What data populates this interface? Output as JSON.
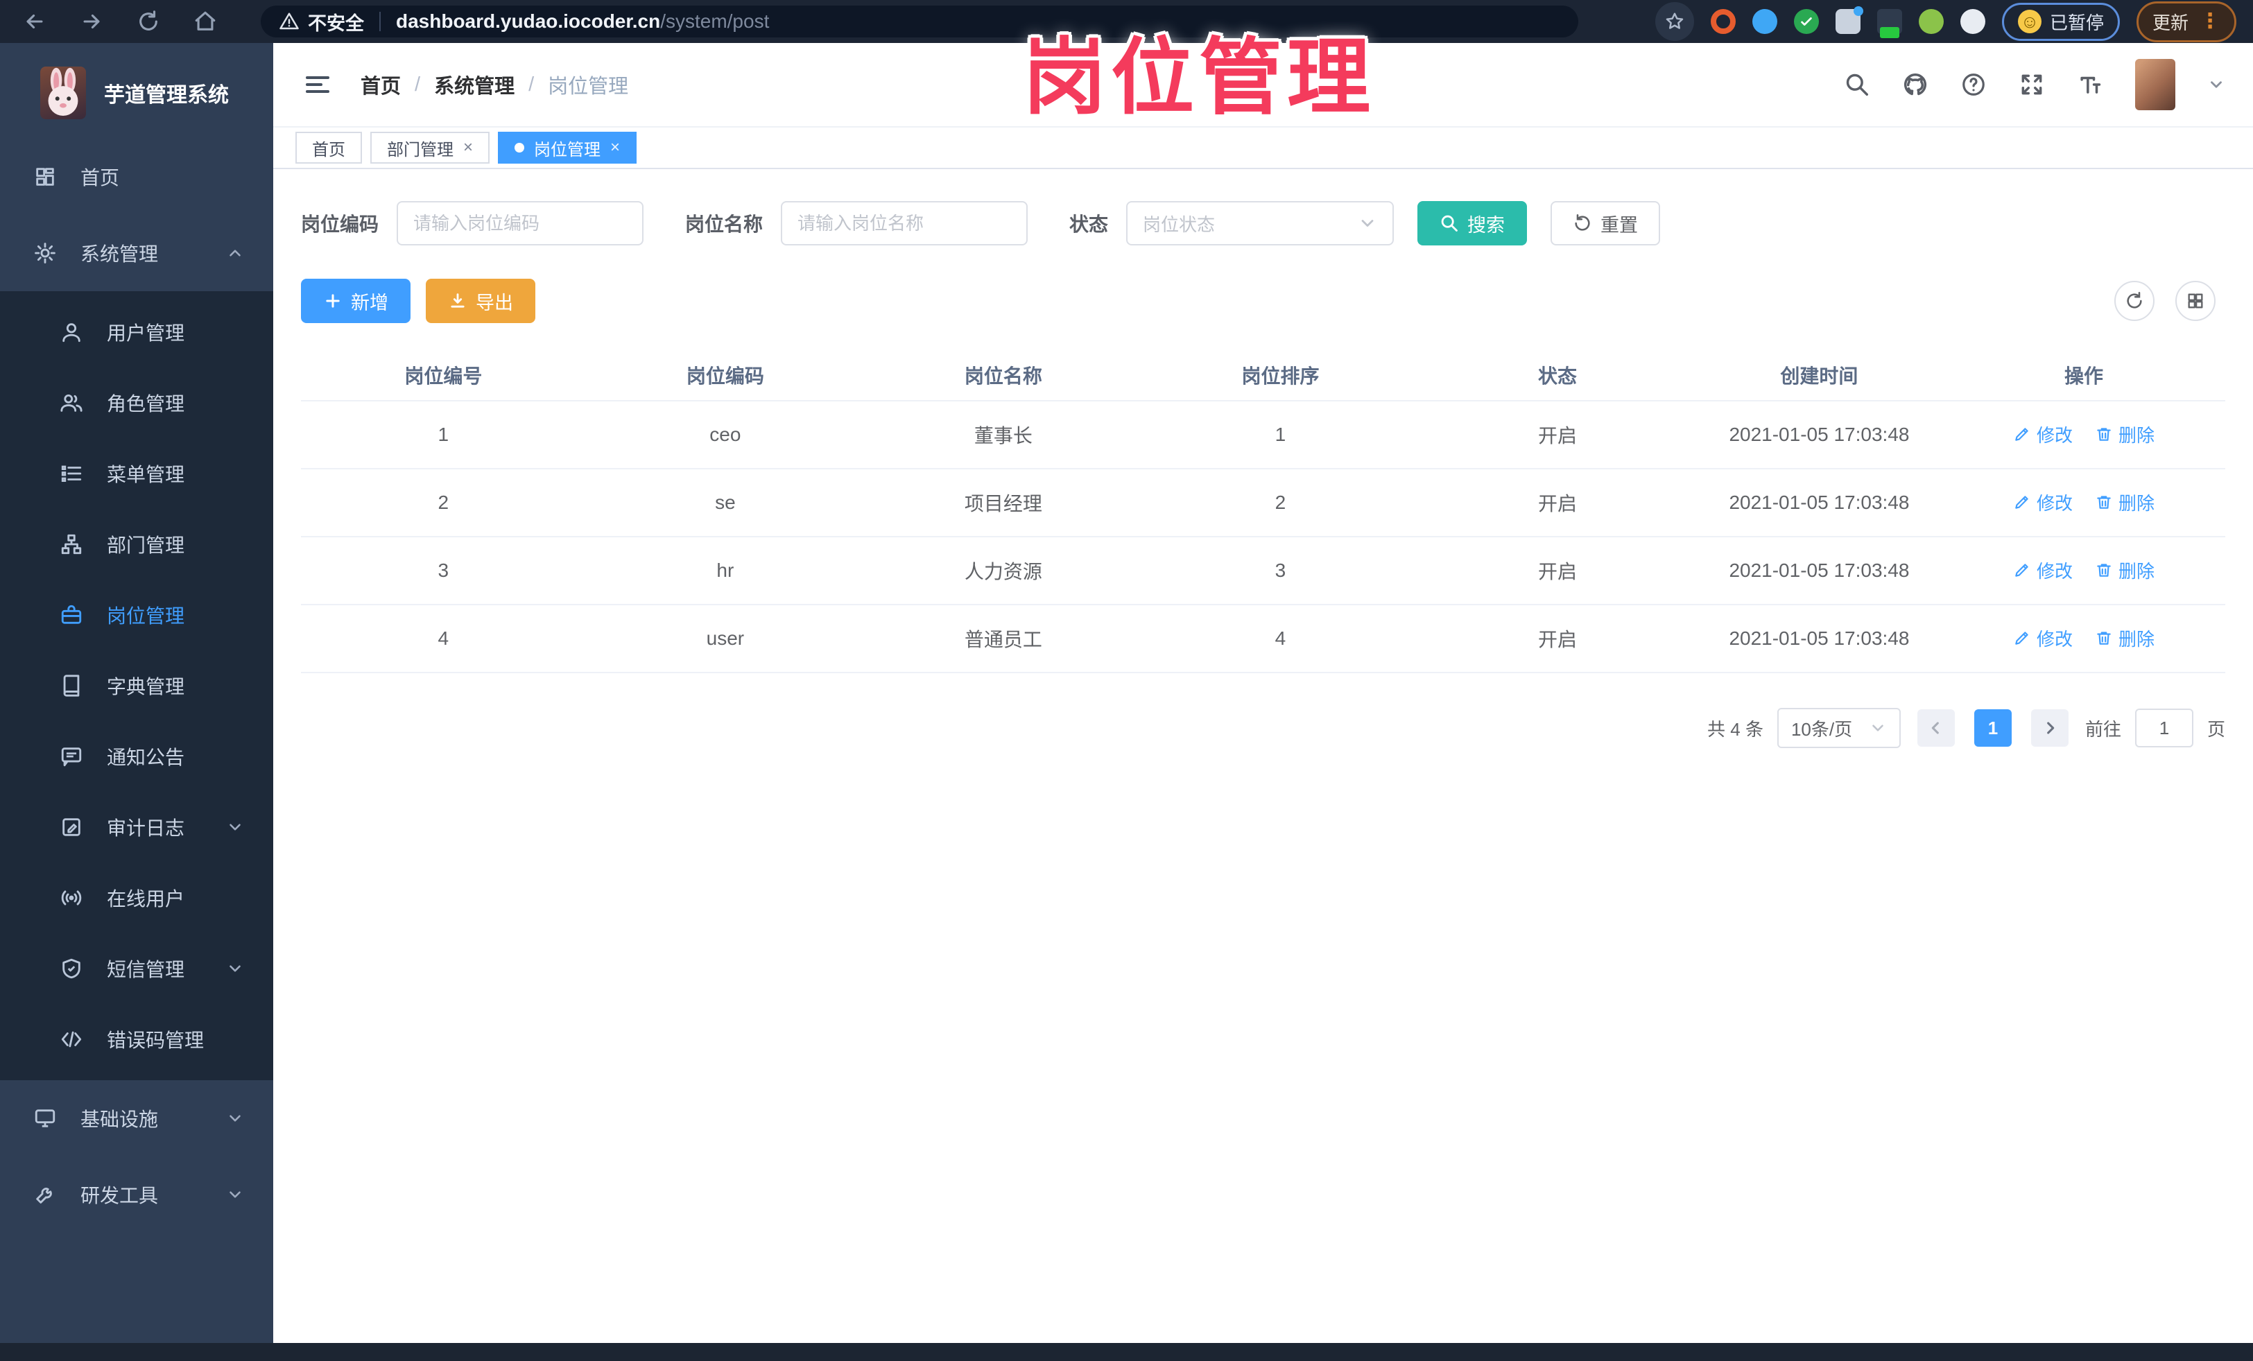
{
  "browser": {
    "security_label": "不安全",
    "url_host": "dashboard.yudao.iocoder.cn",
    "url_path": "/system/post",
    "paused_label": "已暂停",
    "update_label": "更新"
  },
  "watermark": "岗位管理",
  "sidebar": {
    "app_title": "芋道管理系统",
    "home": "首页",
    "system": "系统管理",
    "submenu": [
      {
        "label": "用户管理"
      },
      {
        "label": "角色管理"
      },
      {
        "label": "菜单管理"
      },
      {
        "label": "部门管理"
      },
      {
        "label": "岗位管理"
      },
      {
        "label": "字典管理"
      },
      {
        "label": "通知公告"
      },
      {
        "label": "审计日志"
      },
      {
        "label": "在线用户"
      },
      {
        "label": "短信管理"
      },
      {
        "label": "错误码管理"
      }
    ],
    "infra": "基础设施",
    "devtools": "研发工具"
  },
  "header": {
    "breadcrumb": [
      "首页",
      "系统管理",
      "岗位管理"
    ]
  },
  "tabs": [
    {
      "label": "首页"
    },
    {
      "label": "部门管理"
    },
    {
      "label": "岗位管理"
    }
  ],
  "filters": {
    "code_label": "岗位编码",
    "code_placeholder": "请输入岗位编码",
    "name_label": "岗位名称",
    "name_placeholder": "请输入岗位名称",
    "status_label": "状态",
    "status_placeholder": "岗位状态",
    "search": "搜索",
    "reset": "重置"
  },
  "toolbar": {
    "add": "新增",
    "export": "导出"
  },
  "table": {
    "columns": [
      "岗位编号",
      "岗位编码",
      "岗位名称",
      "岗位排序",
      "状态",
      "创建时间",
      "操作"
    ],
    "edit": "修改",
    "delete": "删除",
    "rows": [
      {
        "id": "1",
        "code": "ceo",
        "name": "董事长",
        "sort": "1",
        "status": "开启",
        "created": "2021-01-05 17:03:48"
      },
      {
        "id": "2",
        "code": "se",
        "name": "项目经理",
        "sort": "2",
        "status": "开启",
        "created": "2021-01-05 17:03:48"
      },
      {
        "id": "3",
        "code": "hr",
        "name": "人力资源",
        "sort": "3",
        "status": "开启",
        "created": "2021-01-05 17:03:48"
      },
      {
        "id": "4",
        "code": "user",
        "name": "普通员工",
        "sort": "4",
        "status": "开启",
        "created": "2021-01-05 17:03:48"
      }
    ]
  },
  "pagination": {
    "total": "共 4 条",
    "page_size": "10条/页",
    "current": "1",
    "goto": "前往",
    "goto_value": "1",
    "page_unit": "页"
  },
  "colors": {
    "accent": "#409eff",
    "search_btn": "#2bbcab",
    "export_btn": "#efa63c",
    "watermark": "#f43b5c",
    "sidebar_bg": "#2f3e55",
    "submenu_bg": "#1d2939",
    "chrome_bg": "#1c2534"
  }
}
